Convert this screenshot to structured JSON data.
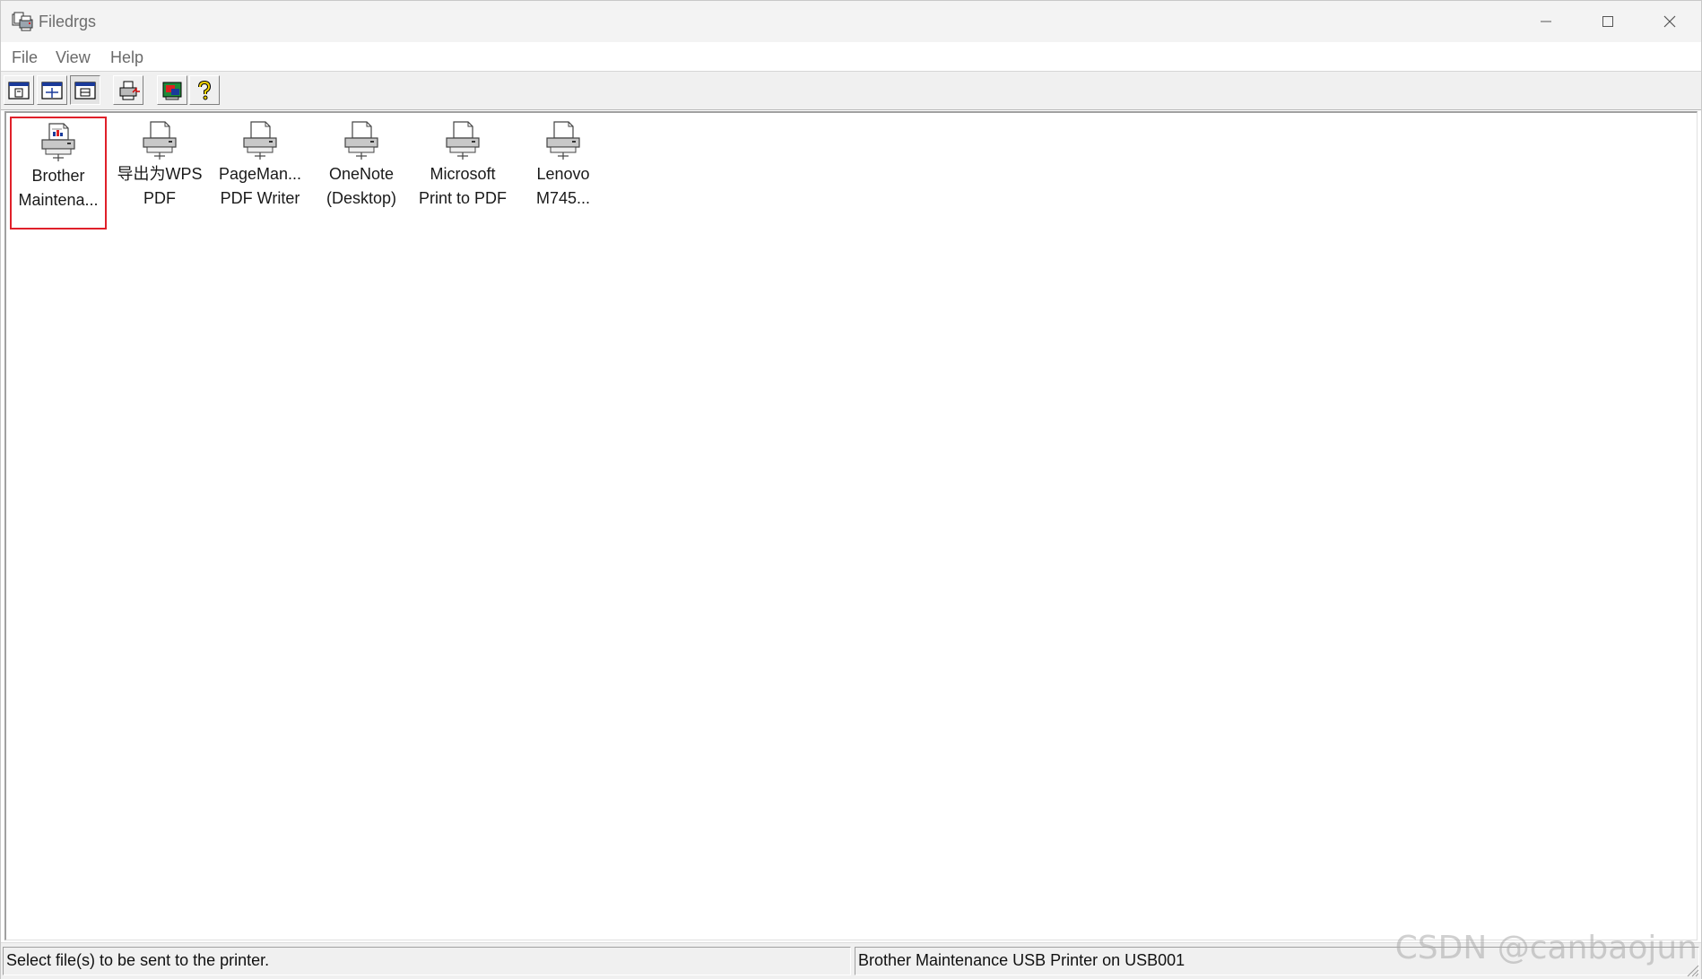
{
  "window": {
    "title": "Filedrgs"
  },
  "menu": {
    "items": [
      "File",
      "View",
      "Help"
    ]
  },
  "toolbar": {
    "buttons": [
      {
        "icon": "large-icons-view-icon"
      },
      {
        "icon": "small-icons-view-icon"
      },
      {
        "icon": "details-view-icon",
        "pressed": true
      },
      {
        "icon": "print-setup-icon"
      },
      {
        "icon": "printer-properties-icon"
      },
      {
        "icon": "help-icon"
      }
    ]
  },
  "printers": [
    {
      "line1": "Brother",
      "line2": "Maintena...",
      "selected": true,
      "badge": true
    },
    {
      "line1": "导出为WPS",
      "line2": "PDF"
    },
    {
      "line1": "PageMan...",
      "line2": "PDF Writer"
    },
    {
      "line1": "OneNote",
      "line2": "(Desktop)"
    },
    {
      "line1": "Microsoft",
      "line2": "Print to PDF"
    },
    {
      "line1": "Lenovo",
      "line2": "M745..."
    }
  ],
  "status": {
    "message": "Select file(s) to be sent to the printer.",
    "printer": "Brother Maintenance USB Printer on USB001"
  },
  "watermark": "CSDN @canbaojun",
  "colors": {
    "selection_border": "#e0202a",
    "help_icon": "#f2d200"
  }
}
